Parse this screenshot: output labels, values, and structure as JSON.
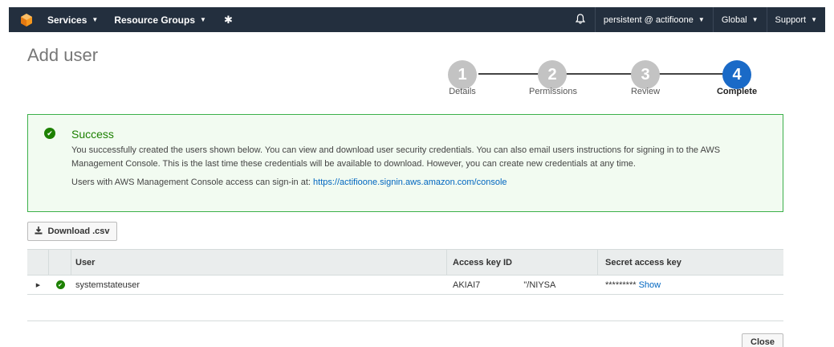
{
  "nav": {
    "services": "Services",
    "resource_groups": "Resource Groups",
    "account": "persistent @ actifioone",
    "region": "Global",
    "support": "Support"
  },
  "page": {
    "title": "Add user"
  },
  "steps": [
    {
      "number": "1",
      "label": "Details"
    },
    {
      "number": "2",
      "label": "Permissions"
    },
    {
      "number": "3",
      "label": "Review"
    },
    {
      "number": "4",
      "label": "Complete"
    }
  ],
  "success": {
    "title": "Success",
    "message": "You successfully created the users shown below. You can view and download user security credentials. You can also email users instructions for signing in to the AWS Management Console. This is the last time these credentials will be available to download. However, you can create new credentials at any time.",
    "signin_prefix": "Users with AWS Management Console access can sign-in at:",
    "signin_url": "https://actifioone.signin.aws.amazon.com/console"
  },
  "download_label": "Download .csv",
  "table": {
    "headers": {
      "user": "User",
      "access_key": "Access key ID",
      "secret": "Secret access key"
    },
    "rows": [
      {
        "user": "systemstateuser",
        "access_key_start": "AKIAI7",
        "access_key_end": "\"/NIYSA",
        "secret_mask": "*********",
        "show": "Show"
      }
    ]
  },
  "close_label": "Close",
  "colors": {
    "nav_bg": "#232f3e",
    "active_step": "#1a6ac7",
    "success_green": "#1d8102",
    "link": "#0066c0"
  }
}
